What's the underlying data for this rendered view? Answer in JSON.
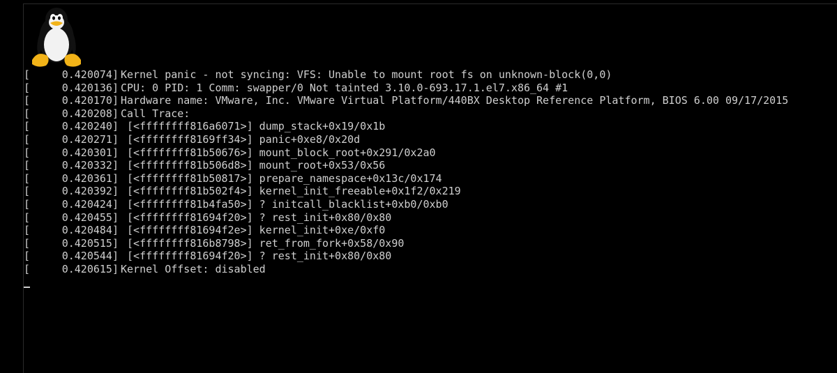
{
  "console": {
    "lines": [
      {
        "bracket": "[",
        "timestamp": "0.420074]",
        "message": "Kernel panic - not syncing: VFS: Unable to mount root fs on unknown-block(0,0)"
      },
      {
        "bracket": "[",
        "timestamp": "0.420136]",
        "message": "CPU: 0 PID: 1 Comm: swapper/0 Not tainted 3.10.0-693.17.1.el7.x86_64 #1"
      },
      {
        "bracket": "[",
        "timestamp": "0.420170]",
        "message": "Hardware name: VMware, Inc. VMware Virtual Platform/440BX Desktop Reference Platform, BIOS 6.00 09/17/2015"
      },
      {
        "bracket": "[",
        "timestamp": "0.420208]",
        "message": "Call Trace:"
      },
      {
        "bracket": "[",
        "timestamp": "0.420240]",
        "message": " [<ffffffff816a6071>] dump_stack+0x19/0x1b"
      },
      {
        "bracket": "[",
        "timestamp": "0.420271]",
        "message": " [<ffffffff8169ff34>] panic+0xe8/0x20d"
      },
      {
        "bracket": "[",
        "timestamp": "0.420301]",
        "message": " [<ffffffff81b50676>] mount_block_root+0x291/0x2a0"
      },
      {
        "bracket": "[",
        "timestamp": "0.420332]",
        "message": " [<ffffffff81b506d8>] mount_root+0x53/0x56"
      },
      {
        "bracket": "[",
        "timestamp": "0.420361]",
        "message": " [<ffffffff81b50817>] prepare_namespace+0x13c/0x174"
      },
      {
        "bracket": "[",
        "timestamp": "0.420392]",
        "message": " [<ffffffff81b502f4>] kernel_init_freeable+0x1f2/0x219"
      },
      {
        "bracket": "[",
        "timestamp": "0.420424]",
        "message": " [<ffffffff81b4fa50>] ? initcall_blacklist+0xb0/0xb0"
      },
      {
        "bracket": "[",
        "timestamp": "0.420455]",
        "message": " [<ffffffff81694f20>] ? rest_init+0x80/0x80"
      },
      {
        "bracket": "[",
        "timestamp": "0.420484]",
        "message": " [<ffffffff81694f2e>] kernel_init+0xe/0xf0"
      },
      {
        "bracket": "[",
        "timestamp": "0.420515]",
        "message": " [<ffffffff816b8798>] ret_from_fork+0x58/0x90"
      },
      {
        "bracket": "[",
        "timestamp": "0.420544]",
        "message": " [<ffffffff81694f20>] ? rest_init+0x80/0x80"
      },
      {
        "bracket": "[",
        "timestamp": "0.420615]",
        "message": "Kernel Offset: disabled"
      }
    ]
  },
  "logo": {
    "icon": "tux-penguin-icon"
  },
  "colors": {
    "background": "#000000",
    "text": "#cfcfcf"
  }
}
